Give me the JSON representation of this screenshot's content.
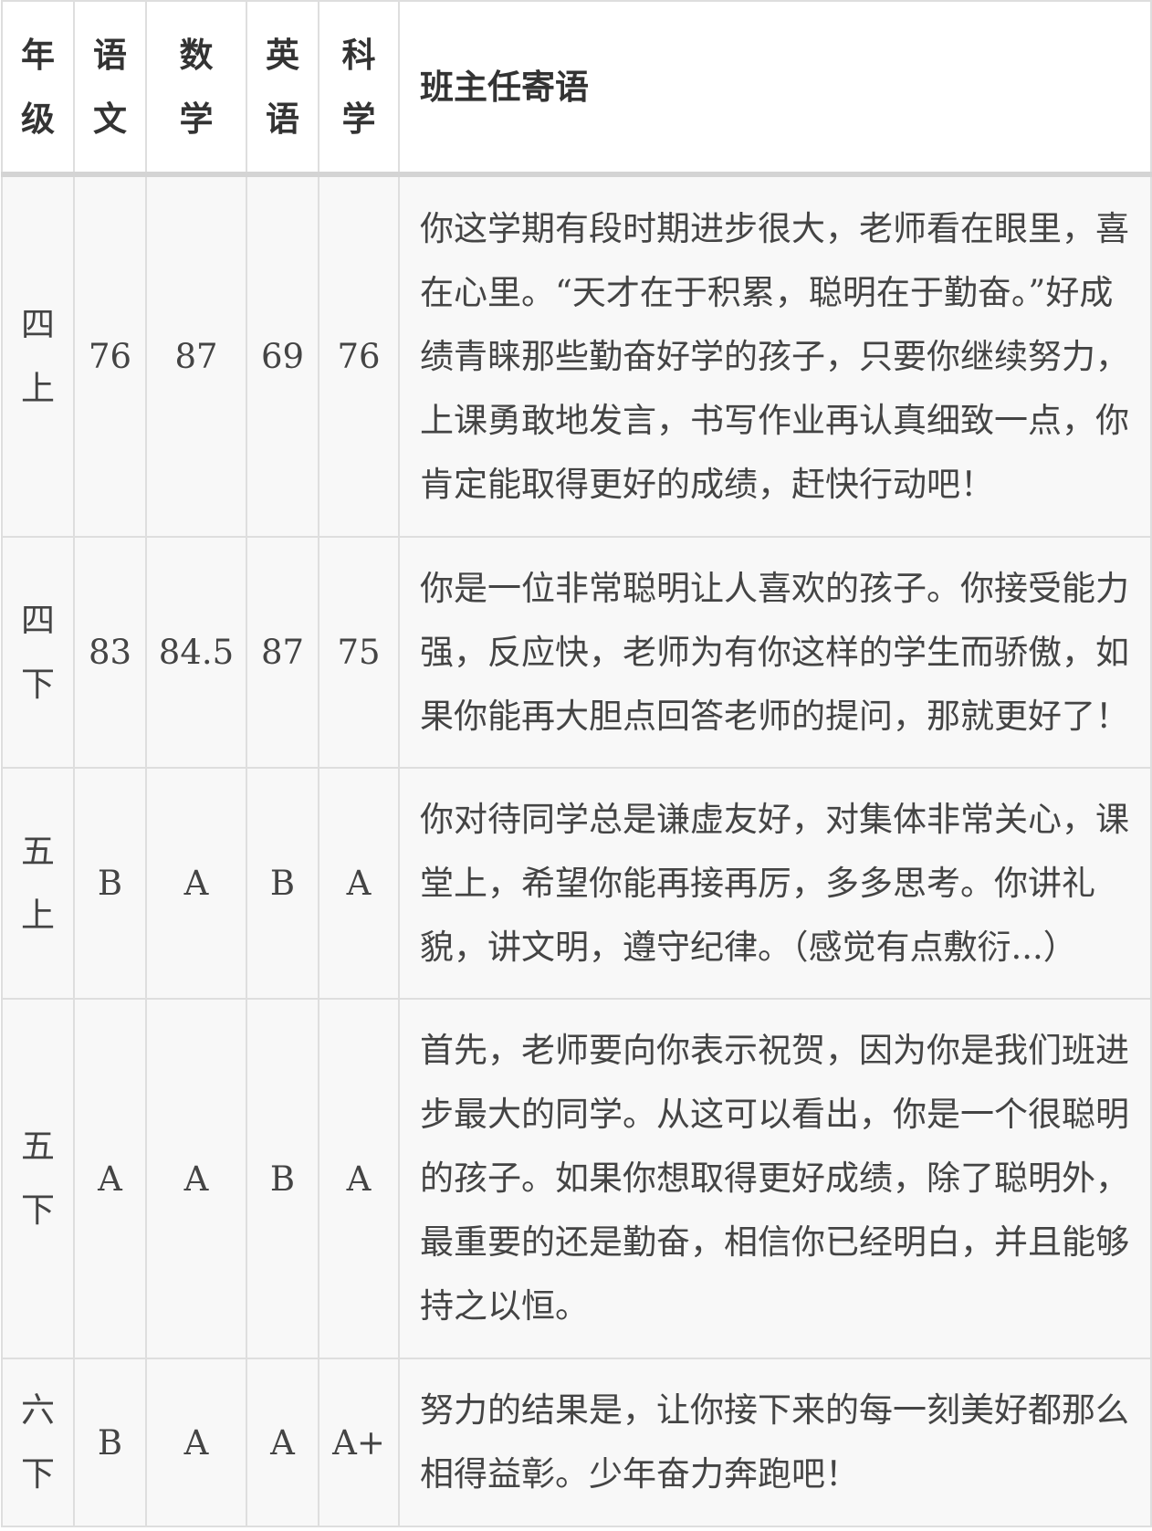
{
  "header": {
    "grade": "年级",
    "chinese": "语文",
    "math": "数学",
    "english": "英语",
    "science": "科学",
    "comment": "班主任寄语"
  },
  "rows": [
    {
      "grade": "四上",
      "chinese": "76",
      "math": "87",
      "english": "69",
      "science": "76",
      "comment": "你这学期有段时期进步很大，老师看在眼里，喜在心里。“天才在于积累，聪明在于勤奋。”好成绩青睐那些勤奋好学的孩子，只要你继续努力，上课勇敢地发言，书写作业再认真细致一点，你肯定能取得更好的成绩，赶快行动吧！"
    },
    {
      "grade": "四下",
      "chinese": "83",
      "math": "84.5",
      "english": "87",
      "science": "75",
      "comment": "你是一位非常聪明让人喜欢的孩子。你接受能力强，反应快，老师为有你这样的学生而骄傲，如果你能再大胆点回答老师的提问，那就更好了！"
    },
    {
      "grade": "五上",
      "chinese": "B",
      "math": "A",
      "english": "B",
      "science": "A",
      "comment": "你对待同学总是谦虚友好，对集体非常关心，课堂上，希望你能再接再厉，多多思考。你讲礼貌，讲文明，遵守纪律。（感觉有点敷衍...）"
    },
    {
      "grade": "五下",
      "chinese": "A",
      "math": "A",
      "english": "B",
      "science": "A",
      "comment": "首先，老师要向你表示祝贺，因为你是我们班进步最大的同学。从这可以看出，你是一个很聪明的孩子。如果你想取得更好成绩，除了聪明外，最重要的还是勤奋，相信你已经明白，并且能够持之以恒。"
    },
    {
      "grade": "六下",
      "chinese": "B",
      "math": "A",
      "english": "A",
      "science": "A+",
      "comment": "努力的结果是，让你接下来的每一刻美好都那么相得益彰。少年奋力奔跑吧！"
    }
  ]
}
